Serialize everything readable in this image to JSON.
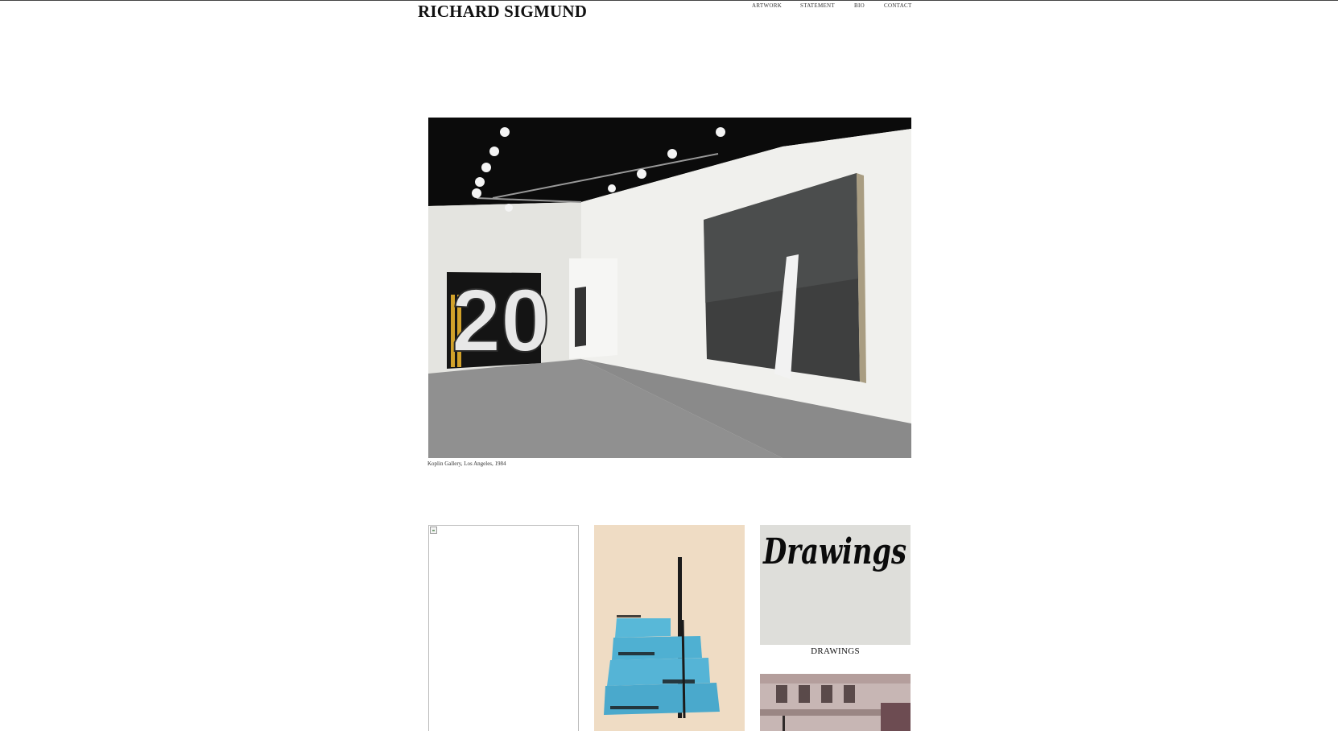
{
  "site": {
    "title": "RICHARD SIGMUND"
  },
  "nav": {
    "items": [
      {
        "label": "ARTWORK"
      },
      {
        "label": "STATEMENT"
      },
      {
        "label": "BIO"
      },
      {
        "label": "CONTACT"
      }
    ]
  },
  "hero": {
    "caption": "Koplin Gallery, Los Angeles, 1984",
    "painting_left_text": "20"
  },
  "gallery": {
    "drawings": {
      "label": "DRAWINGS",
      "image_text": "Drawings"
    }
  },
  "colors": {
    "ceiling": "#0b0b0b",
    "wall": "#ececea",
    "floor": "#8e8e8c",
    "stairs_blue": "#58b8d8",
    "sculpture_bg": "#efdcc4",
    "drawings_bg": "#dededa"
  }
}
